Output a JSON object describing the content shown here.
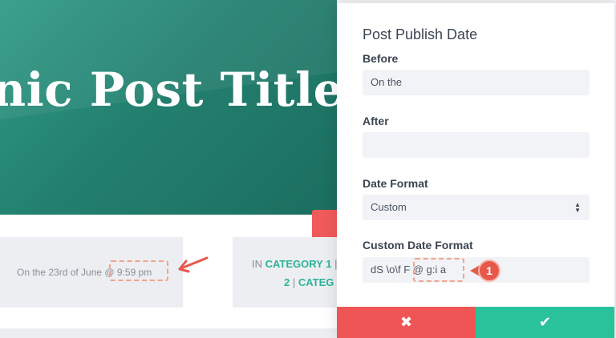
{
  "background_page": {
    "hero_title": "nic Post Title W",
    "meta_date": "On the 23rd of June @ 9:59 pm",
    "category_line1_prefix": "IN ",
    "category_line1_link": "CATEGORY 1",
    "category_line1_sep": " |",
    "category_line2_link1": "2",
    "category_line2_sep": " | ",
    "category_line2_link2": "CATEG"
  },
  "panel": {
    "title": "Post Publish Date",
    "before": {
      "label": "Before",
      "value": "On the"
    },
    "after": {
      "label": "After",
      "value": ""
    },
    "date_format": {
      "label": "Date Format",
      "value": "Custom"
    },
    "custom_date_format": {
      "label": "Custom Date Format",
      "value": "dS \\o\\f F @ g:i a"
    },
    "annotation_number": "1",
    "cancel_icon": "close-icon",
    "confirm_icon": "check-icon"
  },
  "colors": {
    "accent_green": "#29c29a",
    "cancel_red": "#ef5555",
    "annotation_red": "#e8584a"
  }
}
